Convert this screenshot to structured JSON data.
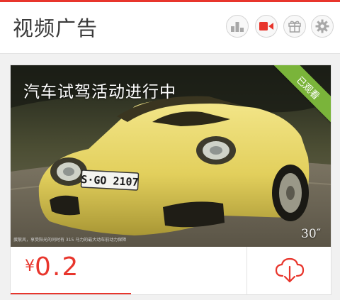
{
  "header": {
    "title": "视频广告",
    "icons": [
      "rank-icon",
      "video-icon",
      "gift-icon",
      "gear-icon"
    ]
  },
  "ad": {
    "title": "汽车试驾活动进行中",
    "badge": "已观看",
    "duration": "30″",
    "plate": "S·GO 2107",
    "caption": "蛋敞风，享受阳光的同时有 315 马力的最大动车前动力保障",
    "price_symbol": "¥",
    "price": "0.2",
    "download_icon": "cloud-download-icon"
  },
  "colors": {
    "accent": "#e8352c",
    "badge": "#7ab43a",
    "car": "#e6d46a"
  }
}
